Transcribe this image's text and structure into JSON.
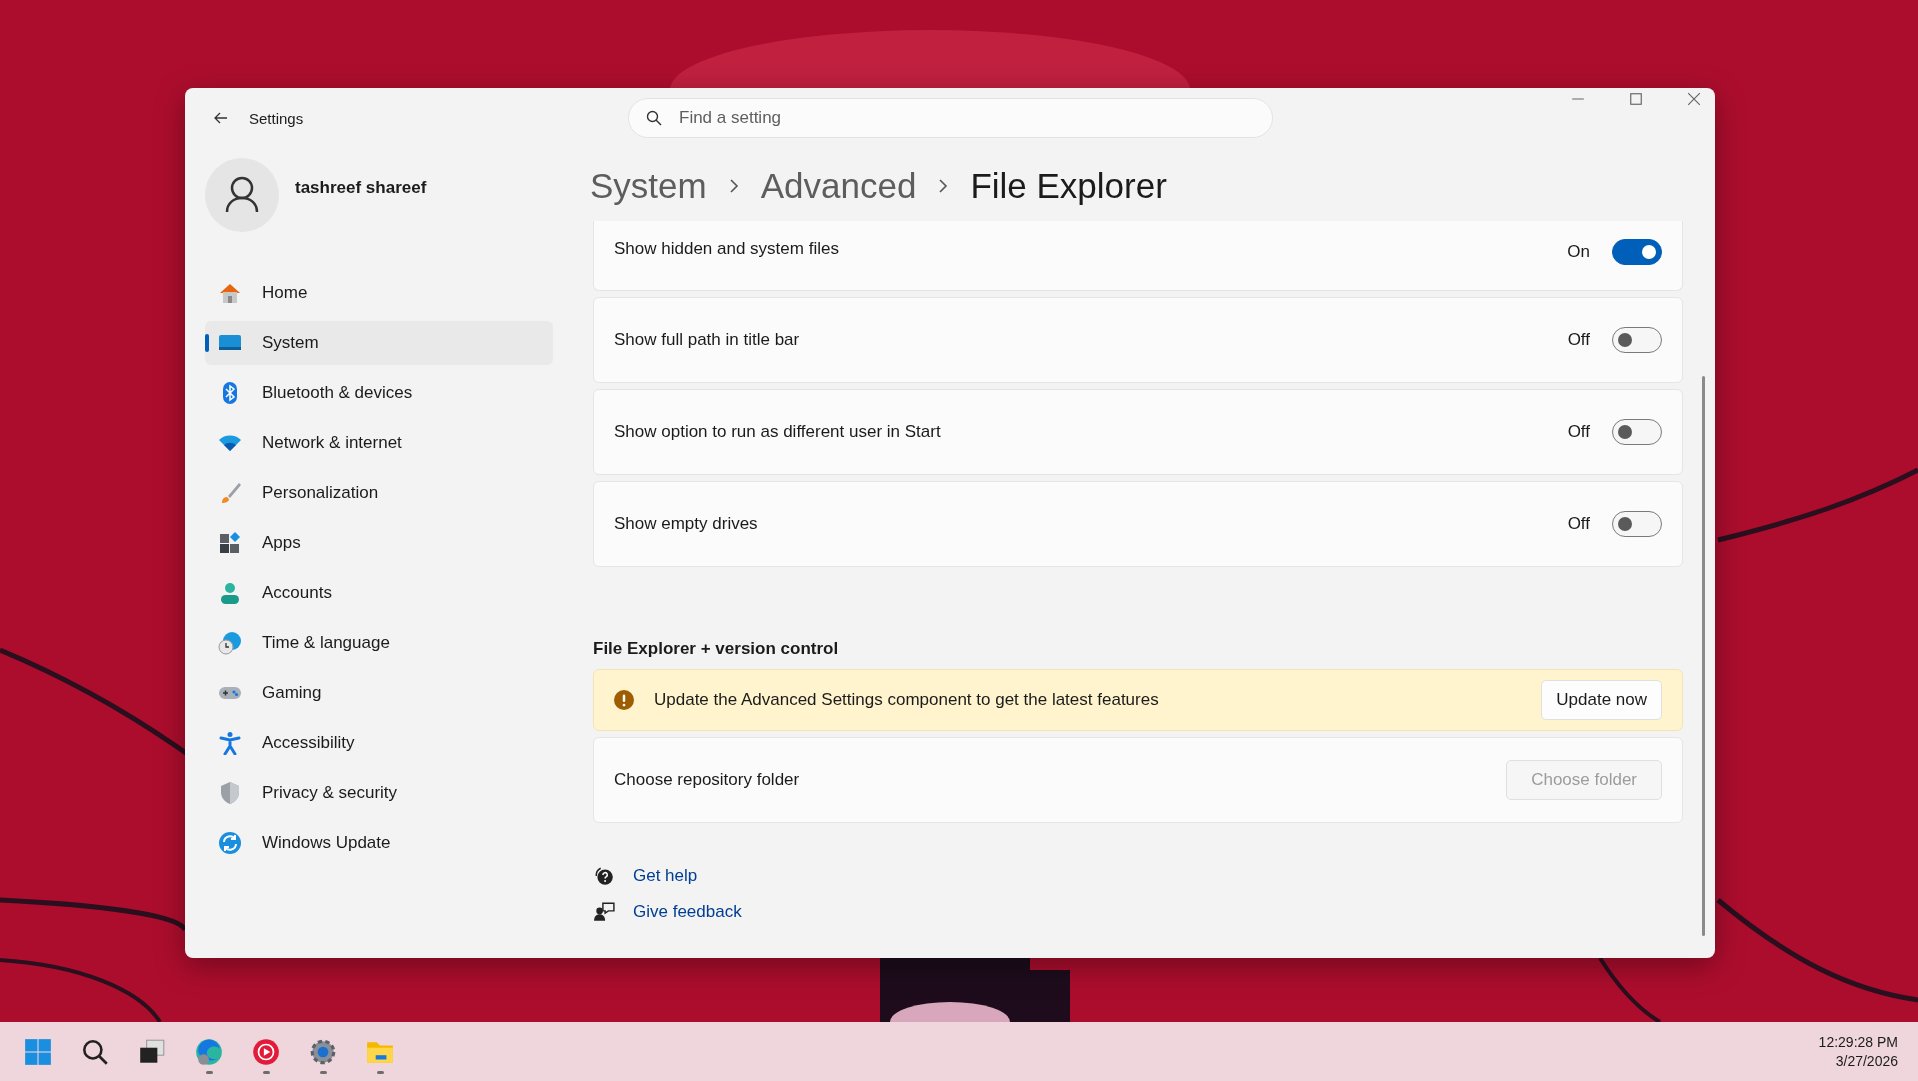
{
  "window": {
    "title": "Settings"
  },
  "search": {
    "placeholder": "Find a setting"
  },
  "user": {
    "name": "tashreef shareef"
  },
  "nav": [
    {
      "label": "Home",
      "selected": false
    },
    {
      "label": "System",
      "selected": true
    },
    {
      "label": "Bluetooth & devices",
      "selected": false
    },
    {
      "label": "Network & internet",
      "selected": false
    },
    {
      "label": "Personalization",
      "selected": false
    },
    {
      "label": "Apps",
      "selected": false
    },
    {
      "label": "Accounts",
      "selected": false
    },
    {
      "label": "Time & language",
      "selected": false
    },
    {
      "label": "Gaming",
      "selected": false
    },
    {
      "label": "Accessibility",
      "selected": false
    },
    {
      "label": "Privacy & security",
      "selected": false
    },
    {
      "label": "Windows Update",
      "selected": false
    }
  ],
  "breadcrumb": [
    "System",
    "Advanced",
    "File Explorer"
  ],
  "settings": [
    {
      "label": "Show hidden and system files",
      "state": "On",
      "on": true
    },
    {
      "label": "Show full path in title bar",
      "state": "Off",
      "on": false
    },
    {
      "label": "Show option to run as different user in Start",
      "state": "Off",
      "on": false
    },
    {
      "label": "Show empty drives",
      "state": "Off",
      "on": false
    }
  ],
  "section": {
    "title": "File Explorer + version control"
  },
  "banner": {
    "text": "Update the Advanced Settings component to get the latest features",
    "button": "Update now"
  },
  "repo": {
    "label": "Choose repository folder",
    "button": "Choose folder",
    "disabled": true
  },
  "links": [
    "Get help",
    "Give feedback"
  ],
  "taskbar": {
    "apps": [
      {
        "running": false
      },
      {
        "running": false
      },
      {
        "running": false
      },
      {
        "running": true
      },
      {
        "running": true
      },
      {
        "running": true
      },
      {
        "running": true
      }
    ],
    "time": "12:29:28 PM",
    "date": "3/27/2026"
  }
}
